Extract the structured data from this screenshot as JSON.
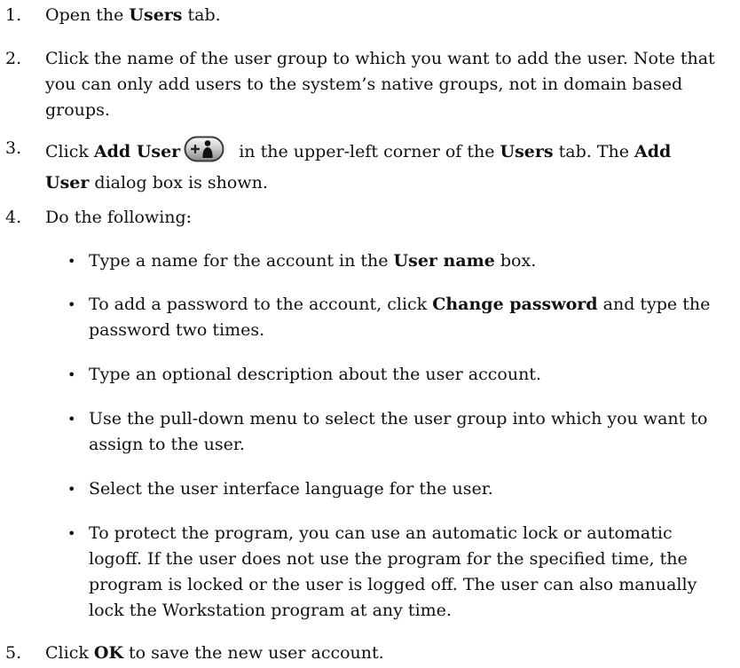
{
  "steps": [
    {
      "num": "1.",
      "pre": "Open the ",
      "b1": "Users",
      "post": " tab."
    },
    {
      "num": "2.",
      "text": "Click the name of the user group to which you want to add the user. Note that you can only add users to the system’s native groups, not in domain based groups."
    },
    {
      "num": "3.",
      "pre": "Click ",
      "b1": "Add User",
      "mid": " in the upper-left corner of the ",
      "b2": "Users",
      "mid2": " tab. The ",
      "b3": "Add User",
      "post": " dialog box is shown."
    },
    {
      "num": "4.",
      "text": "Do the following:"
    },
    {
      "num": "5.",
      "pre": "Click ",
      "b1": "OK",
      "post": " to save the new user account."
    }
  ],
  "bullets": [
    {
      "pre": "Type a name for the account in the ",
      "b": "User name",
      "post": " box."
    },
    {
      "pre": "To add a password to the account, click ",
      "b": "Change password",
      "post": " and type the password two times."
    },
    {
      "text": "Type an optional description about the user account."
    },
    {
      "text": "Use the pull-down menu to select the user group into which you want to assign to the user."
    },
    {
      "text": "Select the user interface language for the user."
    },
    {
      "text": "To protect the program, you can use an automatic lock or automatic logoff. If the user does not use the program for the specified time, the program is locked or the user is logged off. The user can also manually lock the Workstation program at any time."
    }
  ],
  "bullet_symbol": "•",
  "icons": {
    "add_user": "add-user-icon"
  }
}
